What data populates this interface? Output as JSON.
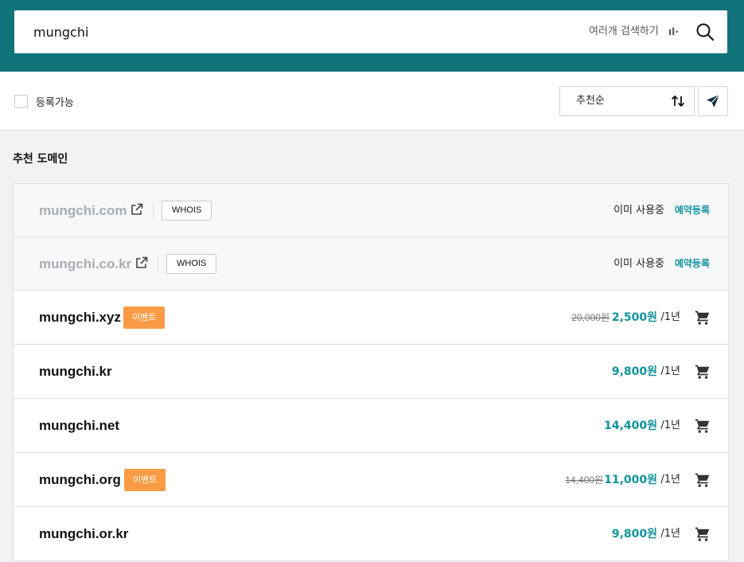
{
  "search": {
    "query": "mungchi",
    "multi_search_label": "여러개 검색하기",
    "multi_icon_glyph": "ıl·"
  },
  "filter": {
    "available_only_label": "등록가능",
    "available_only_checked": false,
    "sort_label": "추천순"
  },
  "section": {
    "title": "추천 도메인"
  },
  "taken_domains": [
    {
      "name": "mungchi.com",
      "whois_label": "WHOIS",
      "status": "이미 사용중",
      "reserve_label": "예약등록"
    },
    {
      "name": "mungchi.co.kr",
      "whois_label": "WHOIS",
      "status": "이미 사용중",
      "reserve_label": "예약등록"
    }
  ],
  "available_domains": [
    {
      "name": "mungchi.xyz",
      "badge": "이벤트",
      "old_price": "20,000원",
      "price": "2,500원",
      "period": "/1년"
    },
    {
      "name": "mungchi.kr",
      "badge": "",
      "old_price": "",
      "price": "9,800원",
      "period": "/1년"
    },
    {
      "name": "mungchi.net",
      "badge": "",
      "old_price": "",
      "price": "14,400원",
      "period": "/1년"
    },
    {
      "name": "mungchi.org",
      "badge": "이벤트",
      "old_price": "14,400원",
      "price": "11,000원",
      "period": "/1년"
    },
    {
      "name": "mungchi.or.kr",
      "badge": "",
      "old_price": "",
      "price": "9,800원",
      "period": "/1년"
    }
  ],
  "colors": {
    "header_bg": "#11737a",
    "accent_teal": "#11939a",
    "event_badge": "#f99b45"
  },
  "icons": {
    "search": "search-icon",
    "sort": "sort-arrows-icon",
    "send": "send-icon",
    "external": "external-link-icon",
    "cart": "cart-icon"
  }
}
